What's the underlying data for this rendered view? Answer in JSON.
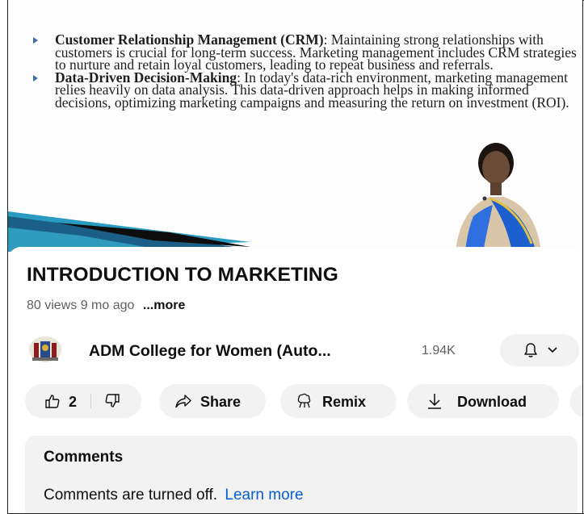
{
  "slide": {
    "bullet1_bold": "Customer Relationship Management (CRM)",
    "bullet1_text": ": Maintaining strong relationships with customers is crucial for long-term success. Marketing management includes CRM strategies to nurture and retain loyal customers, leading to repeat business and referrals.",
    "bullet2_bold": "Data-Driven Decision-Making",
    "bullet2_text": ": In today's data-rich environment, marketing management relies heavily on data analysis. This data-driven approach helps in making informed decisions, optimizing marketing campaigns and measuring the return on investment (ROI)."
  },
  "video": {
    "title": "INTRODUCTION TO MARKETING",
    "views": "80 views",
    "age": "9 mo ago",
    "more": "...more"
  },
  "channel": {
    "name": "ADM College for Women (Auto...",
    "subscribers": "1.94K"
  },
  "actions": {
    "likes": "2",
    "share": "Share",
    "remix": "Remix",
    "download": "Download"
  },
  "comments": {
    "heading": "Comments",
    "status": "Comments are turned off.",
    "link": "Learn more"
  },
  "colors": {
    "accent_link": "#065fd4",
    "chip_bg": "#f2f2f2",
    "bullet": "#3b6da8"
  },
  "icons": [
    "like-icon",
    "dislike-icon",
    "share-icon",
    "remix-icon",
    "download-icon",
    "bell-icon",
    "chevron-down-icon"
  ]
}
